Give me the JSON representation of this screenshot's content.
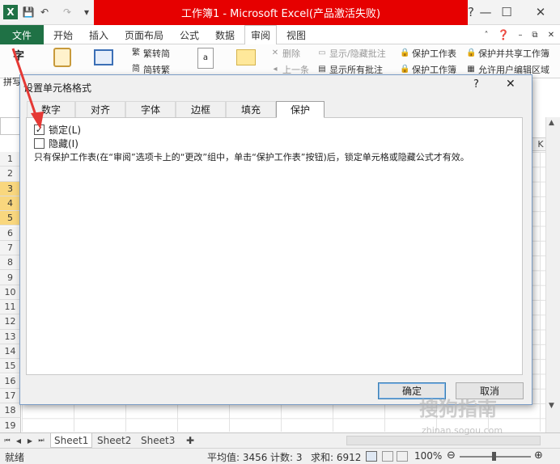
{
  "window": {
    "title": "工作簿1 - Microsoft Excel(产品激活失败)",
    "controls": {
      "help": "?",
      "minimize": "—",
      "restore": "☐",
      "close": "✕"
    }
  },
  "qat": {
    "app_icon": "X",
    "save": "💾",
    "undo": "↶",
    "redo": "↷",
    "customize": "▾"
  },
  "ribbon_tabs": [
    "文件",
    "开始",
    "插入",
    "页面布局",
    "公式",
    "数据",
    "审阅",
    "视图"
  ],
  "ribbon": {
    "left_label": "字",
    "cut_label": "拼写",
    "trad_to_simp": "繁转简",
    "simp_to_trad": "简转繁",
    "delete": "删除",
    "prev": "上一条",
    "show_hide_comment": "显示/隐藏批注",
    "show_all_comments": "显示所有批注",
    "protect_sheet": "保护工作表",
    "protect_workbook": "保护工作簿",
    "protect_share": "保护并共享工作簿",
    "allow_edit": "允许用户编辑区域"
  },
  "sheet": {
    "rows": [
      "1",
      "2",
      "3",
      "4",
      "5",
      "6",
      "7",
      "8",
      "9",
      "10",
      "11",
      "12",
      "13",
      "14",
      "15",
      "16",
      "17",
      "18",
      "19"
    ],
    "selected_rows": [
      "3",
      "4",
      "5"
    ],
    "visible_column": "K",
    "tabs": [
      "Sheet1",
      "Sheet2",
      "Sheet3"
    ]
  },
  "status": {
    "ready": "就绪",
    "average": "平均值: 3456",
    "count": "计数: 3",
    "sum": "求和: 6912",
    "zoom": "100%"
  },
  "dialog": {
    "title": "设置单元格格式",
    "help": "?",
    "close": "✕",
    "tabs": [
      "数字",
      "对齐",
      "字体",
      "边框",
      "填充",
      "保护"
    ],
    "active_tab": "保护",
    "locked_label": "锁定(L)",
    "locked_checked": true,
    "hidden_label": "隐藏(I)",
    "hidden_checked": false,
    "note": "只有保护工作表(在“审阅”选项卡上的“更改”组中，单击“保护工作表”按钮)后，锁定单元格或隐藏公式才有效。",
    "ok": "确定",
    "cancel": "取消"
  },
  "watermark": {
    "main": "搜狗指南",
    "sub": "zhinan.sogou.com"
  },
  "colors": {
    "excel_green": "#1f7145",
    "title_red": "#e60000",
    "annotation_red": "#e53935",
    "selected_row": "#f9d77e"
  }
}
